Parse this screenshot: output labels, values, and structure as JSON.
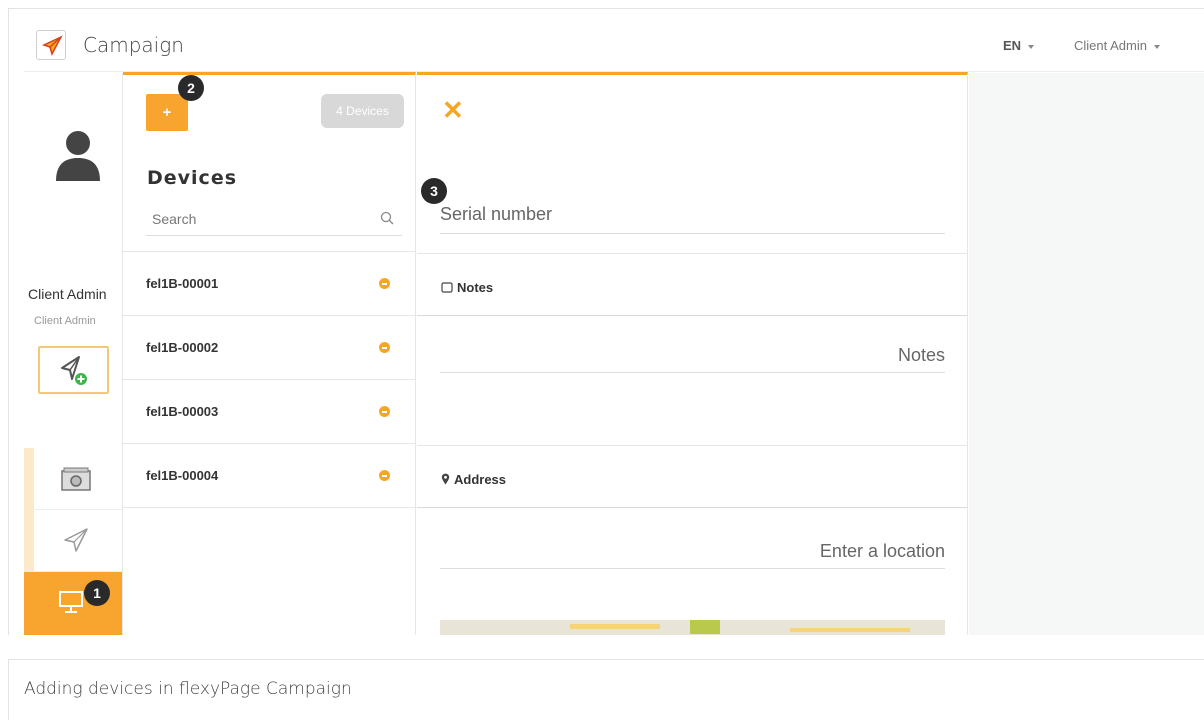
{
  "app": {
    "title": "Campaign"
  },
  "header": {
    "language": "EN",
    "user_menu": "Client Admin"
  },
  "sidebar": {
    "user_name": "Client Admin",
    "user_role": "Client Admin",
    "items": [
      "camera-icon",
      "send-icon",
      "monitor-icon"
    ],
    "active_item": "monitor-icon"
  },
  "devices": {
    "title": "Devices",
    "count_label": "4 Devices",
    "search_placeholder": "Search",
    "list": [
      {
        "name": "fel1B-00001",
        "status": "minus"
      },
      {
        "name": "fel1B-00002",
        "status": "minus"
      },
      {
        "name": "fel1B-00003",
        "status": "minus"
      },
      {
        "name": "fel1B-00004",
        "status": "minus"
      }
    ]
  },
  "detail": {
    "serial_placeholder": "Serial number",
    "notes_label": "Notes",
    "notes_placeholder": "Notes",
    "address_label": "Address",
    "location_placeholder": "Enter a location"
  },
  "badges": {
    "one": "1",
    "two": "2",
    "three": "3"
  },
  "caption": "Adding devices in flexyPage Campaign",
  "colors": {
    "accent": "#f5a623",
    "badge": "#2a2a2a",
    "pill": "#d8d8d8"
  }
}
